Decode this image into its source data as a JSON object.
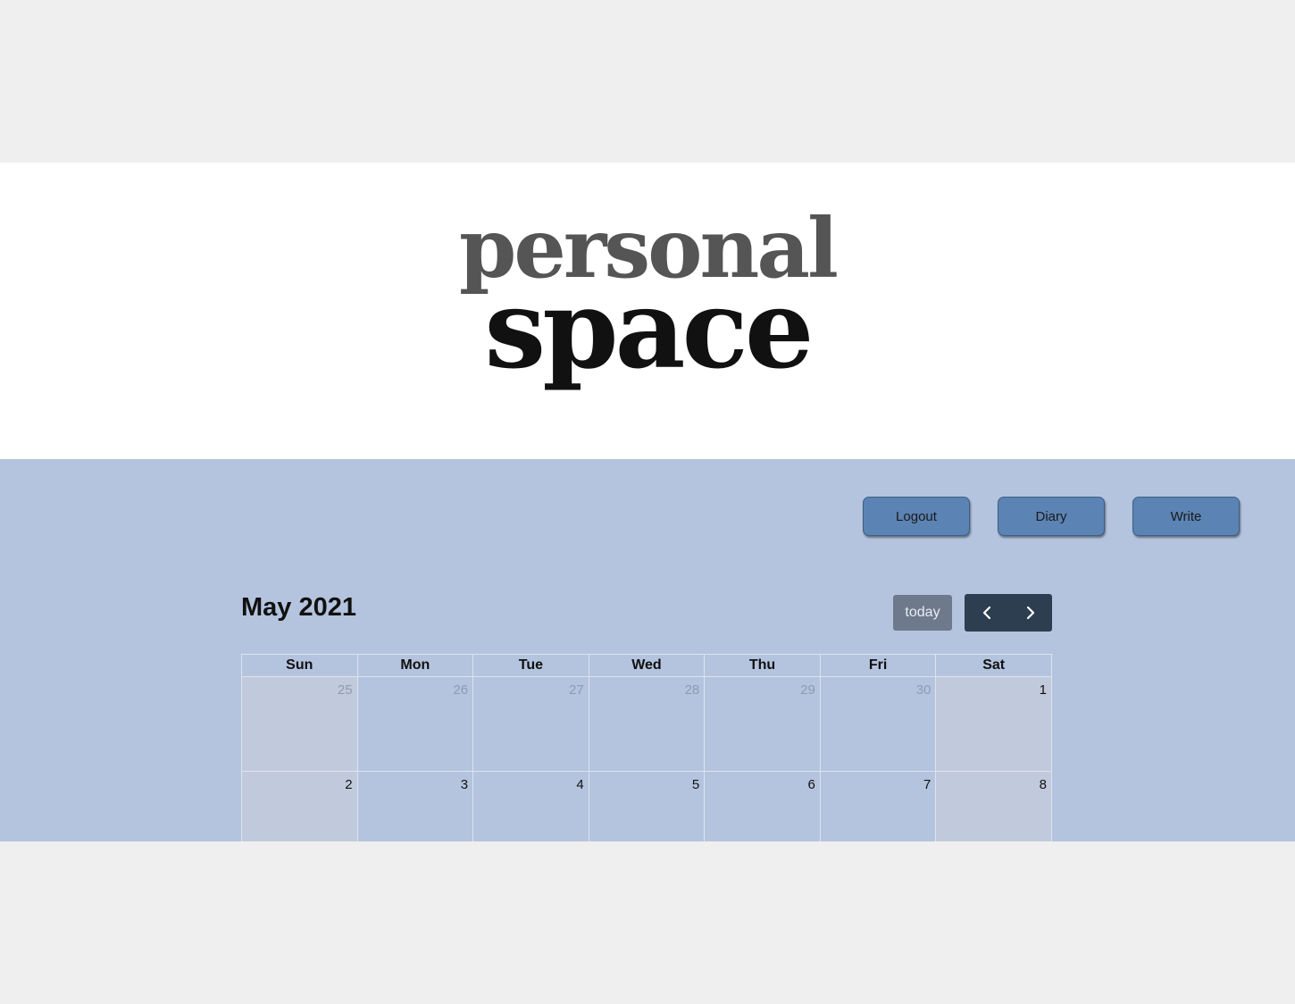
{
  "logo": {
    "line1": "personal",
    "line2": "space"
  },
  "nav": {
    "logout": "Logout",
    "diary": "Diary",
    "write": "Write"
  },
  "calendar": {
    "title": "May 2021",
    "today_label": "today",
    "prev_icon": "chevron-left-icon",
    "next_icon": "chevron-right-icon",
    "weekdays": [
      "Sun",
      "Mon",
      "Tue",
      "Wed",
      "Thu",
      "Fri",
      "Sat"
    ],
    "weeks": [
      [
        "25",
        "26",
        "27",
        "28",
        "29",
        "30",
        "1"
      ],
      [
        "2",
        "3",
        "4",
        "5",
        "6",
        "7",
        "8"
      ]
    ]
  },
  "colors": {
    "page_background": "#efefef",
    "header_background": "#ffffff",
    "main_background": "#b4c4de",
    "nav_button": "#5b83b3",
    "today_button": "#6e7a8c",
    "arrow_group": "#2c3e50"
  }
}
